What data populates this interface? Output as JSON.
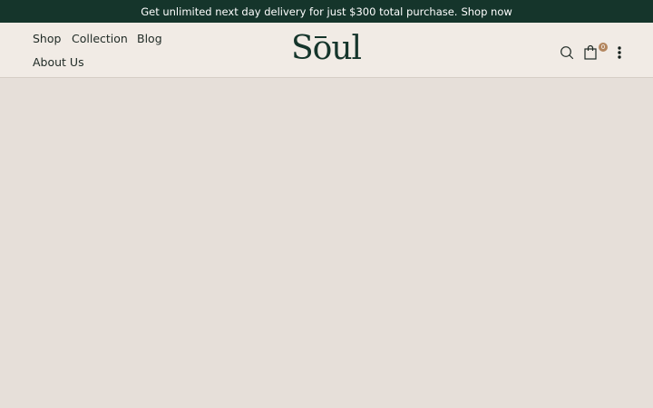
{
  "announcement": {
    "text": "Get unlimited next day delivery for just $300 total purchase.",
    "link_label": "Shop now"
  },
  "nav": {
    "items": [
      {
        "label": "Shop"
      },
      {
        "label": "Collection"
      },
      {
        "label": "Blog"
      },
      {
        "label": "About Us"
      }
    ]
  },
  "brand": {
    "logo_text": "Soul"
  },
  "header_icons": {
    "search": "search-icon",
    "cart": "shopping-bag-icon",
    "cart_count": "0",
    "more": "more-vertical-icon"
  },
  "colors": {
    "announcement_bg": "#15352b",
    "header_bg": "#f1ebe5",
    "page_bg": "#e6dfd9",
    "badge": "#b3865f",
    "brand": "#15352b"
  }
}
